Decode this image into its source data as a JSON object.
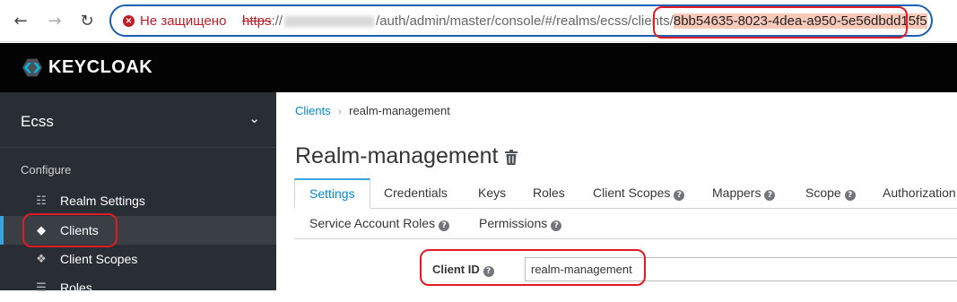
{
  "browser": {
    "back_glyph": "←",
    "forward_glyph": "→",
    "reload_glyph": "↻",
    "security_warning": "Не защищено",
    "url_scheme": "https",
    "url_scheme_sep": "://",
    "url_path": "/auth/admin/master/console/#/realms/ecss/clients/",
    "url_selected": "8bb54635-8023-4dea-a950-5e56dbdd15f5"
  },
  "app": {
    "logo_text": "KEYCLOAK"
  },
  "sidebar": {
    "realm": "Ecss",
    "realm_chevron": "⌄",
    "section": "Configure",
    "items": [
      {
        "label": "Realm Settings",
        "icon": "sliders-icon",
        "glyph": "☷"
      },
      {
        "label": "Clients",
        "icon": "cube-icon",
        "glyph": "◆"
      },
      {
        "label": "Client Scopes",
        "icon": "cubes-icon",
        "glyph": "❖"
      },
      {
        "label": "Roles",
        "icon": "list-icon",
        "glyph": "☰"
      }
    ]
  },
  "breadcrumb": {
    "parent": "Clients",
    "separator": "›",
    "current": "realm-management"
  },
  "page": {
    "title": "Realm-management"
  },
  "tabs": {
    "row1": [
      "Settings",
      "Credentials",
      "Keys",
      "Roles",
      "Client Scopes",
      "Mappers",
      "Scope",
      "Authorization"
    ],
    "row2": [
      "Service Account Roles",
      "Permissions"
    ]
  },
  "form": {
    "client_id_label": "Client ID",
    "client_id_value": "realm-management"
  },
  "help_glyph": "?",
  "colors": {
    "annotation": "#e01b24",
    "link": "#0088ce",
    "sidebar_bg": "#292e34",
    "header_bg": "#030303",
    "active_accent": "#39a5dc",
    "warning": "#c01c28"
  }
}
